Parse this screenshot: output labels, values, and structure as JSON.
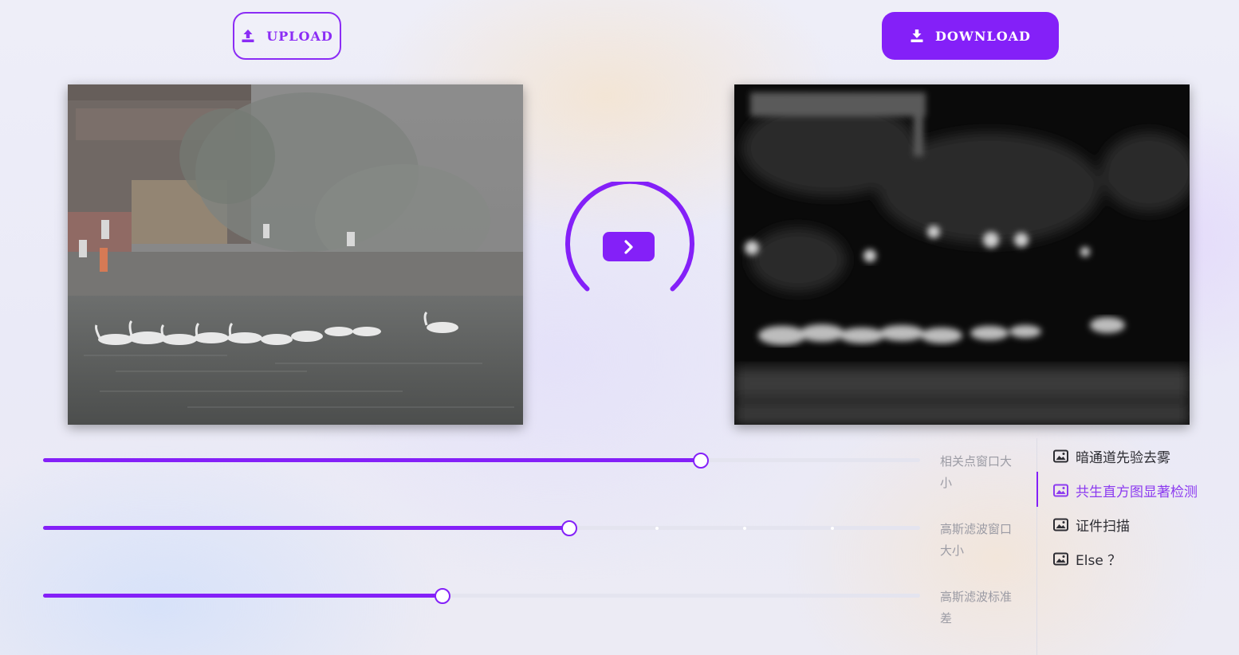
{
  "toolbar": {
    "upload_label": "UPLOAD",
    "download_label": "DOWNLOAD"
  },
  "panels": {
    "input_icon": "image-icon",
    "output_icon": "image-icon"
  },
  "process": {
    "run_icon": "chevron-right-icon"
  },
  "sliders": [
    {
      "label": "相关点窗口大小",
      "value_fraction": 0.75
    },
    {
      "label": "高斯滤波窗口大小",
      "value_fraction": 0.6,
      "tick_marks": 3
    },
    {
      "label": "高斯滤波标准差",
      "value_fraction": 0.455
    }
  ],
  "menu": {
    "items": [
      {
        "label": "暗通道先验去雾",
        "icon": "image-icon",
        "active": false
      },
      {
        "label": "共生直方图显著检测",
        "icon": "image-icon",
        "active": true
      },
      {
        "label": "证件扫描",
        "icon": "image-icon",
        "active": false
      },
      {
        "label": "Else ？",
        "icon": "image-icon",
        "active": false
      }
    ]
  },
  "colors": {
    "accent": "#8420f8",
    "track": "#e4e4ef",
    "label": "#9b9ba4",
    "menu_text": "#2d2d33",
    "menu_active": "#8c3bf0"
  }
}
